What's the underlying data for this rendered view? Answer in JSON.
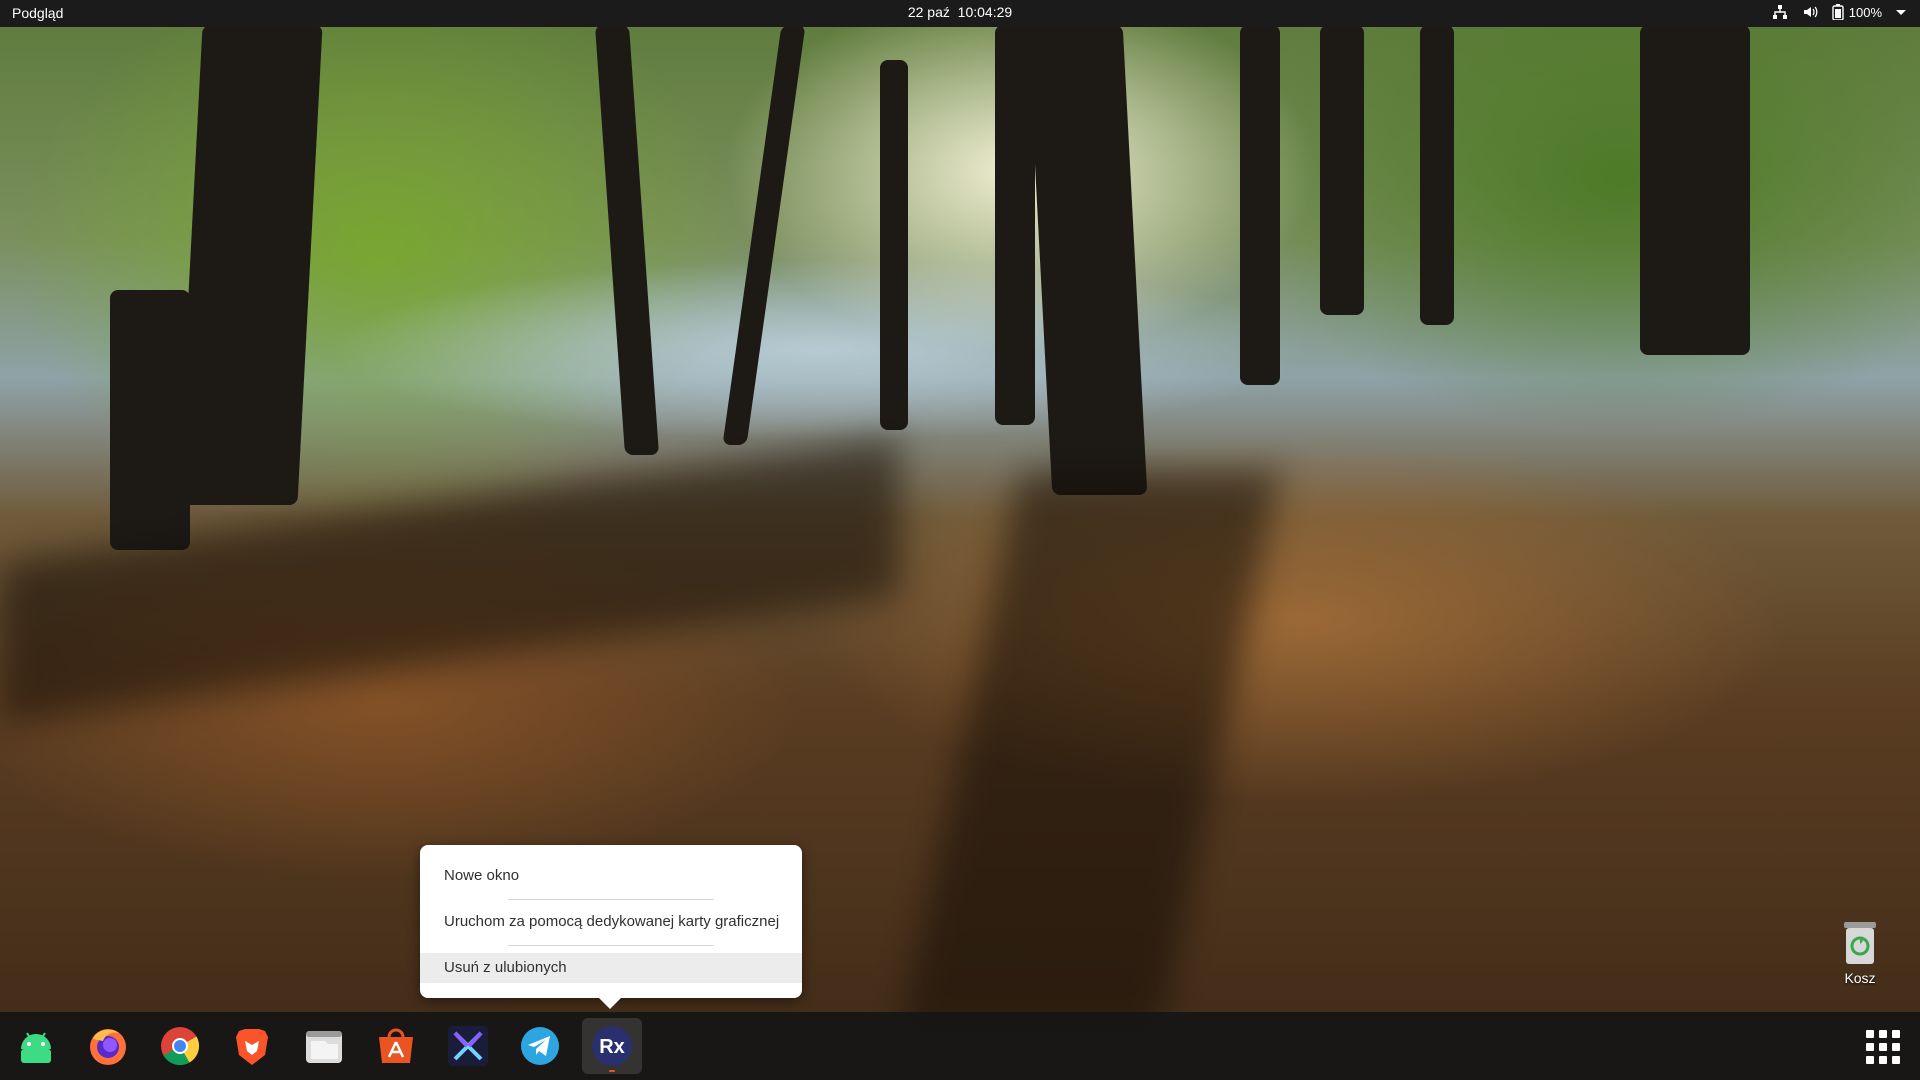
{
  "topbar": {
    "activities_label": "Podgląd",
    "date": "22 paź",
    "time": "10:04:29",
    "battery_percent": "100%",
    "icons": [
      "network-icon",
      "volume-icon",
      "battery-icon",
      "system-menu-chevron-icon"
    ]
  },
  "context_menu": {
    "items": [
      {
        "label": "Nowe okno"
      },
      {
        "label": "Uruchom za pomocą dedykowanej karty graficznej"
      },
      {
        "label": "Usuń z ulubionych"
      }
    ],
    "hovered_index": 2
  },
  "desktop": {
    "trash_label": "Kosz"
  },
  "dock": {
    "items": [
      {
        "name": "android-studio-icon",
        "active": false
      },
      {
        "name": "firefox-icon",
        "active": false
      },
      {
        "name": "chrome-icon",
        "active": false
      },
      {
        "name": "brave-icon",
        "active": false
      },
      {
        "name": "files-icon",
        "active": false
      },
      {
        "name": "software-center-icon",
        "active": false
      },
      {
        "name": "exodus-icon",
        "active": false
      },
      {
        "name": "telegram-icon",
        "active": false
      },
      {
        "name": "rx-app-icon",
        "active": true
      }
    ],
    "show_apps_icon": "app-grid-icon"
  },
  "colors": {
    "topbar_bg": "#1b1b1b",
    "dock_bg": "#161616",
    "menu_bg": "#ffffff",
    "menu_hover": "#ececec",
    "accent": "#e95420"
  }
}
